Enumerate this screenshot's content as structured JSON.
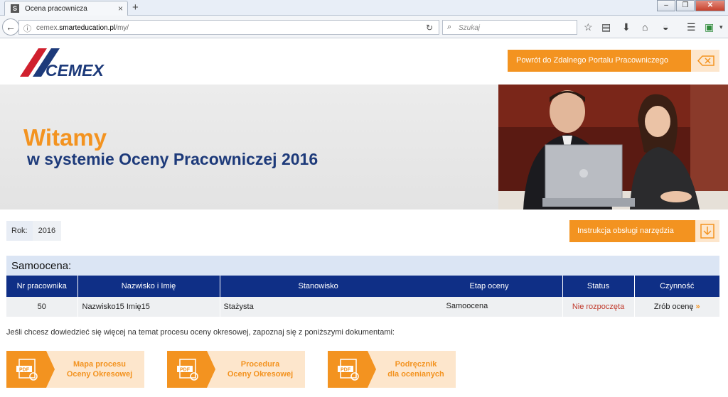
{
  "browser": {
    "tab_title": "Ocena pracownicza",
    "tab_favicon": "S",
    "new_tab_symbol": "+",
    "url_prefix": "cemex.",
    "url_domain": "smarteducation.pl",
    "url_path": "/my/",
    "search_placeholder": "Szukaj"
  },
  "header": {
    "logo_text": "CEMEX",
    "portal_button": "Powrót do Zdalnego Portalu Pracowniczego"
  },
  "banner": {
    "welcome": "Witamy",
    "subtitle": "w systemie Oceny Pracowniczej 2016"
  },
  "year": {
    "label": "Rok:",
    "value": "2016"
  },
  "instruction_button": "Instrukcja obsługi narzędzia",
  "section_title": "Samoocena:",
  "table": {
    "headers": [
      "Nr pracownika",
      "Nazwisko i Imię",
      "Stanowisko",
      "Etap oceny",
      "Status",
      "Czynność"
    ],
    "rows": [
      {
        "nr": "50",
        "name": "Nazwisko15 Imię15",
        "position": "Stażysta",
        "stage": "Samoocena",
        "status": "Nie rozpoczęta",
        "action": "Zrób ocenę",
        "action_arrow": "»"
      }
    ]
  },
  "info_text": "Jeśli chcesz dowiedzieć się więcej na temat procesu oceny okresowej, zapoznaj się z poniższymi dokumentami:",
  "documents": [
    {
      "line1": "Mapa procesu",
      "line2": "Oceny Okresowej"
    },
    {
      "line1": "Procedura",
      "line2": "Oceny Okresowej"
    },
    {
      "line1": "Podręcznik",
      "line2": "dla ocenianych"
    }
  ],
  "pdf_label": "PDF",
  "colors": {
    "accent": "#f39320",
    "navy": "#0f2f86",
    "logo_red": "#d0202e",
    "logo_blue": "#1d3a7a"
  },
  "icons": [
    "back-arrow-icon",
    "info-icon",
    "reload-icon",
    "search-icon",
    "star-icon",
    "reading-list-icon",
    "download-icon",
    "home-icon",
    "pocket-icon",
    "menu-icon",
    "extension-icon",
    "close-x-icon",
    "download-box-icon",
    "pdf-icon"
  ]
}
